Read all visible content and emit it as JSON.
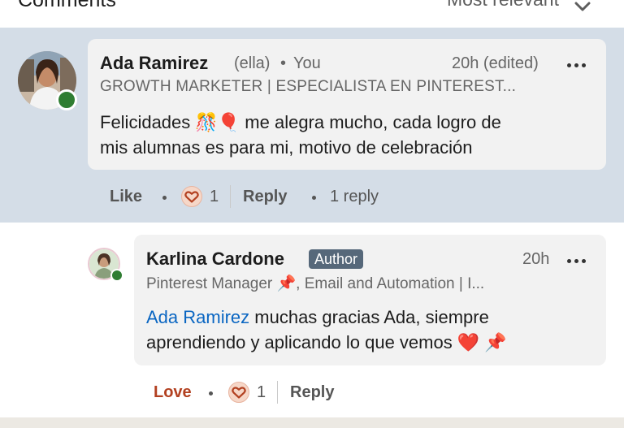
{
  "header": {
    "title": "Comments",
    "sort_label": "Most relevant"
  },
  "comment": {
    "author": "Ada Ramirez",
    "pronoun": "(ella)",
    "separator": "•",
    "relation": "You",
    "time": "20h (edited)",
    "headline": "GROWTH MARKETER | ESPECIALISTA EN PINTEREST...",
    "text_line1": "Felicidades 🎊🎈 me alegra mucho, cada logro de",
    "text_line2": "mis alumnas es para mi, motivo de celebración",
    "like_label": "Like",
    "reaction_count": "1",
    "reply_label": "Reply",
    "replies_label": "1 reply"
  },
  "reply": {
    "author": "Karlina Cardone",
    "badge": "Author",
    "time": "20h",
    "headline": "Pinterest Manager 📌, Email and Automation | I...",
    "mention": "Ada Ramirez",
    "text_line1": " muchas gracias Ada, siempre",
    "text_line2": "aprendiendo y aplicando lo que vemos ❤️ 📌",
    "love_label": "Love",
    "reaction_count": "1",
    "reply_label": "Reply"
  },
  "colors": {
    "highlight_band": "#d4dde7",
    "bubble": "#f2f2f2",
    "mention": "#0a66c2",
    "love": "#b24020",
    "author_badge": "#56687a",
    "presence": "#2f7d32"
  },
  "icons": [
    "chevron-down-icon",
    "more-options-icon",
    "heart-reaction-icon",
    "presence-dot-icon",
    "pin-icon"
  ]
}
